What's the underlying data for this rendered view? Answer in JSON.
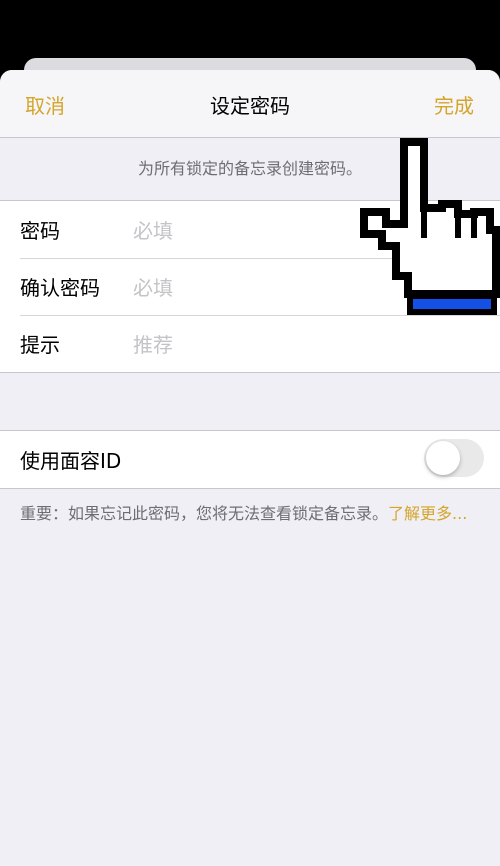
{
  "nav": {
    "cancel": "取消",
    "title": "设定密码",
    "done": "完成"
  },
  "description": "为所有锁定的备忘录创建密码。",
  "fields": [
    {
      "label": "密码",
      "placeholder": "必填"
    },
    {
      "label": "确认密码",
      "placeholder": "必填"
    },
    {
      "label": "提示",
      "placeholder": "推荐"
    }
  ],
  "face_id": {
    "label": "使用面容ID",
    "enabled": false
  },
  "footer": {
    "text": "重要：如果忘记此密码，您将无法查看锁定备忘录。",
    "link": "了解更多..."
  },
  "colors": {
    "accent": "#d4a52a",
    "background": "#f0eff5",
    "cursor_cuff": "#1450e6"
  },
  "cursor_icon": "pointing-hand-icon"
}
